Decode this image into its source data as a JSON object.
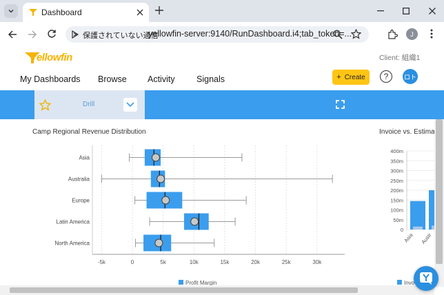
{
  "browser": {
    "tab_title": "Dashboard",
    "security_label": "保護されていない通信",
    "url": "yellowfin-server:9140/RunDashboard.i4;tab_token=...",
    "profile_initial": "J"
  },
  "app": {
    "logo": "Yellowfin",
    "client_label": "Client: 組織1",
    "nav": [
      "My Dashboards",
      "Browse",
      "Activity",
      "Signals"
    ],
    "create_label": "Create",
    "help_label": "?",
    "avatar_label": "ロト"
  },
  "toolbar": {
    "drill_label": "Drill"
  },
  "colors": {
    "accent": "#3b9ded",
    "brand_yellow": "#ffc515",
    "box_fill": "#3b9ded"
  },
  "chart_data": [
    {
      "type": "box",
      "title": "Camp Regional Revenue Distribution",
      "categories": [
        "Asia",
        "Australia",
        "Europe",
        "Latin America",
        "North America"
      ],
      "boxes": [
        {
          "min": -0.5,
          "q1": 2.0,
          "median": 3.5,
          "q3": 4.6,
          "max": 17.8,
          "mean": 3.8
        },
        {
          "min": -5.0,
          "q1": 3.0,
          "median": 4.4,
          "q3": 5.3,
          "max": 32.5,
          "mean": 4.6
        },
        {
          "min": 0.4,
          "q1": 2.3,
          "median": 5.3,
          "q3": 8.1,
          "max": 18.5,
          "mean": 5.4
        },
        {
          "min": 2.8,
          "q1": 8.4,
          "median": 10.8,
          "q3": 12.4,
          "max": 16.7,
          "mean": 10.1
        },
        {
          "min": 0.5,
          "q1": 1.8,
          "median": 4.6,
          "q3": 6.3,
          "max": 13.3,
          "mean": 4.3
        }
      ],
      "xticks": [
        "-5k",
        "0",
        "5k",
        "10k",
        "15k",
        "20k",
        "25k",
        "30k"
      ],
      "xtick_values": [
        -5,
        0,
        5,
        10,
        15,
        20,
        25,
        30
      ],
      "xlim": [
        -6.5,
        34.5
      ],
      "legend": [
        "Profit Margin"
      ]
    },
    {
      "type": "bar",
      "title": "Invoice vs. Estima",
      "categories": [
        "Asia",
        "Austr"
      ],
      "yticks": [
        "400m",
        "350m",
        "300m",
        "250m",
        "200m",
        "150m",
        "100m",
        "50m",
        "0"
      ],
      "ylim": [
        0,
        400
      ],
      "series": [
        {
          "values": [
            145,
            200
          ]
        },
        {
          "values": [
            15,
            20
          ]
        }
      ],
      "legend": [
        "Invo"
      ]
    }
  ]
}
